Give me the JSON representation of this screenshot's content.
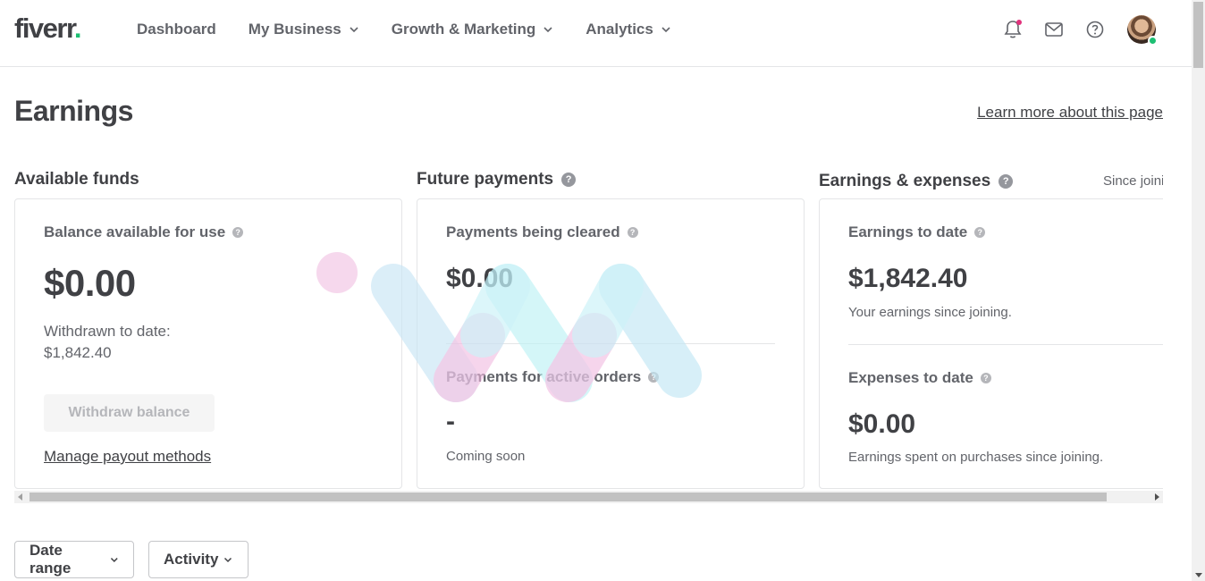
{
  "header": {
    "logo_text": "fiverr",
    "logo_dot": ".",
    "nav": [
      {
        "label": "Dashboard",
        "dropdown": false
      },
      {
        "label": "My Business",
        "dropdown": true
      },
      {
        "label": "Growth & Marketing",
        "dropdown": true
      },
      {
        "label": "Analytics",
        "dropdown": true
      }
    ],
    "icons": [
      "bell-icon",
      "envelope-icon",
      "help-icon"
    ],
    "colors": {
      "brand_green": "#1dbf73",
      "notification": "#e1327c"
    }
  },
  "page": {
    "title": "Earnings",
    "learn_more": "Learn more about this page"
  },
  "available_funds": {
    "section_title": "Available funds",
    "balance_label": "Balance available for use",
    "balance_value": "$0.00",
    "withdrawn_label": "Withdrawn to date:",
    "withdrawn_value": "$1,842.40",
    "withdraw_button": "Withdraw balance",
    "manage_link": "Manage payout methods"
  },
  "future_payments": {
    "section_title": "Future payments",
    "cleared_label": "Payments being cleared",
    "cleared_value": "$0.00",
    "active_label": "Payments for active orders",
    "active_value": "-",
    "active_note": "Coming soon"
  },
  "earnings_expenses": {
    "section_title": "Earnings & expenses",
    "since_text": "Since joining",
    "earnings_label": "Earnings to date",
    "earnings_value": "$1,842.40",
    "earnings_note": "Your earnings since joining.",
    "expenses_label": "Expenses to date",
    "expenses_value": "$0.00",
    "expenses_note": "Earnings spent on purchases since joining."
  },
  "filters": {
    "date_range": "Date range",
    "activity": "Activity"
  },
  "help_glyph": "?"
}
